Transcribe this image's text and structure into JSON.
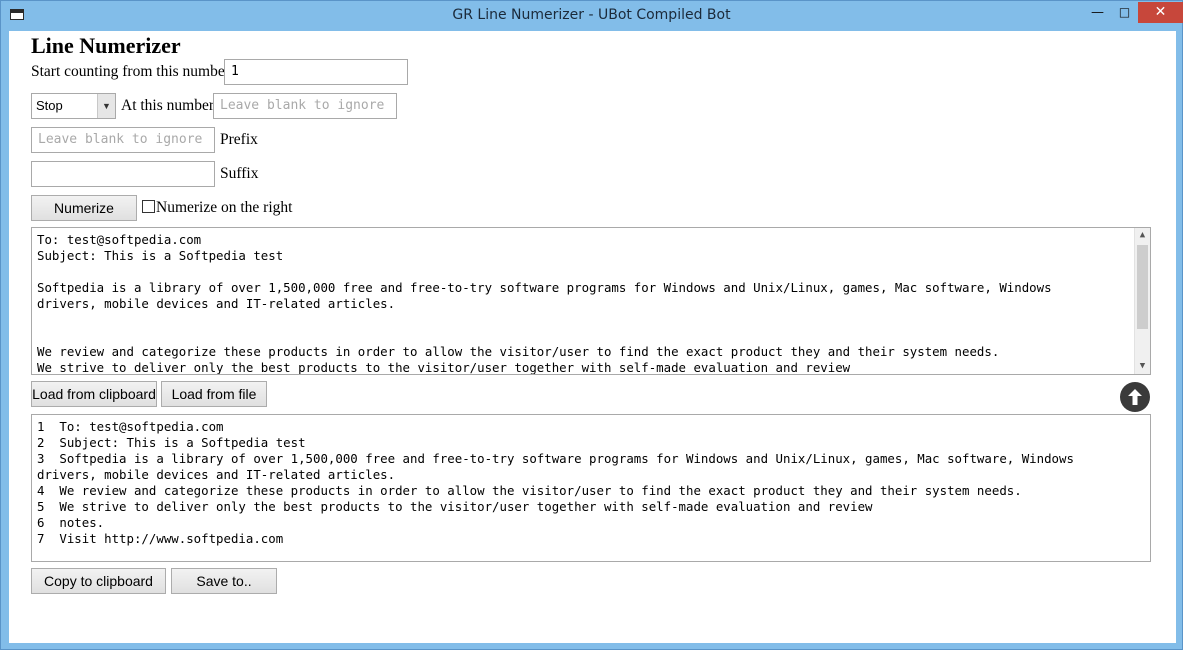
{
  "window": {
    "title": "GR Line Numerizer - UBot Compiled Bot",
    "controls": {
      "minimize": "—",
      "maximize": "□",
      "close": "✕"
    }
  },
  "heading": "Line Numerizer",
  "start": {
    "label": "Start counting from this number",
    "value": "1"
  },
  "stop": {
    "selected": "Stop",
    "at_label": "At this number",
    "placeholder": "Leave blank to ignore"
  },
  "prefix": {
    "placeholder": "Leave blank to ignore",
    "label": "Prefix"
  },
  "suffix": {
    "value": "",
    "label": "Suffix"
  },
  "numerize": {
    "button": "Numerize",
    "checkbox_label": "Numerize on the right",
    "checked": false
  },
  "input_text": {
    "lines": [
      "To: test@softpedia.com",
      "Subject: This is a Softpedia test",
      "",
      "Softpedia is a library of over 1,500,000 free and free-to-try software programs for Windows and Unix/Linux, games, Mac software, Windows",
      "drivers, mobile devices and IT-related articles.",
      "",
      "",
      "We review and categorize these products in order to allow the visitor/user to find the exact product they and their system needs.",
      "We strive to deliver only the best products to the visitor/user together with self-made evaluation and review"
    ]
  },
  "load": {
    "clipboard": "Load from clipboard",
    "file": "Load from file"
  },
  "output_text": {
    "lines": [
      "1  To: test@softpedia.com",
      "2  Subject: This is a Softpedia test",
      "3  Softpedia is a library of over 1,500,000 free and free-to-try software programs for Windows and Unix/Linux, games, Mac software, Windows",
      "drivers, mobile devices and IT-related articles.",
      "4  We review and categorize these products in order to allow the visitor/user to find the exact product they and their system needs.",
      "5  We strive to deliver only the best products to the visitor/user together with self-made evaluation and review",
      "6  notes.",
      "7  Visit http://www.softpedia.com"
    ]
  },
  "actions": {
    "copy": "Copy to clipboard",
    "save": "Save to.."
  }
}
